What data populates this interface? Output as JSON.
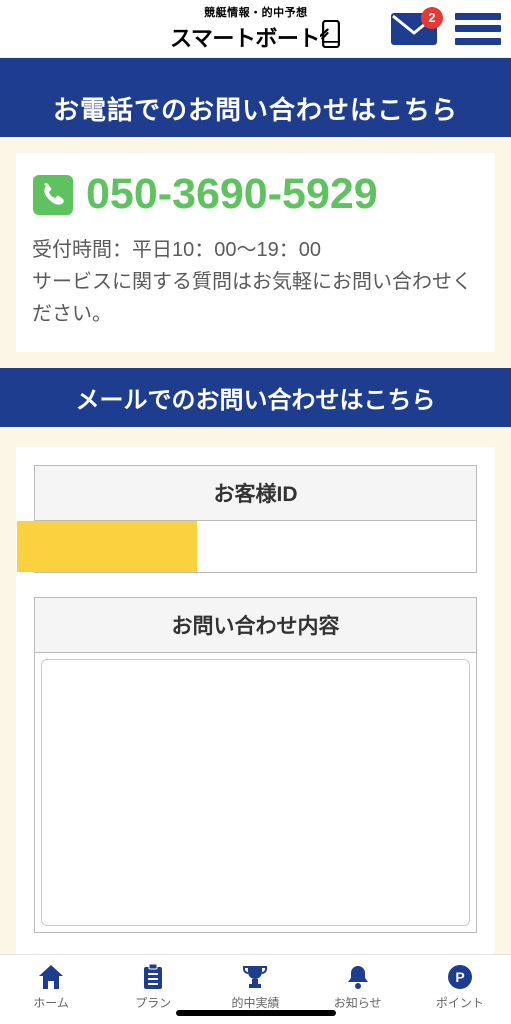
{
  "header": {
    "logo_tag": "競艇情報・的中予想",
    "logo_main": "スマートボート",
    "badge_count": "2"
  },
  "phone_section": {
    "heading": "お電話でのお問い合わせはこちら",
    "number": "050-3690-5929",
    "hours_line1": "受付時間：平日10：00～19：00",
    "hours_line2": "サービスに関する質問はお気軽にお問い合わせください。"
  },
  "mail_section": {
    "heading": "メールでのお問い合わせはこちら",
    "id_label": "お客様ID",
    "content_label": "お問い合わせ内容"
  },
  "nav": {
    "home": "ホーム",
    "plan": "プラン",
    "results": "的中実績",
    "notice": "お知らせ",
    "point": "ポイント"
  }
}
